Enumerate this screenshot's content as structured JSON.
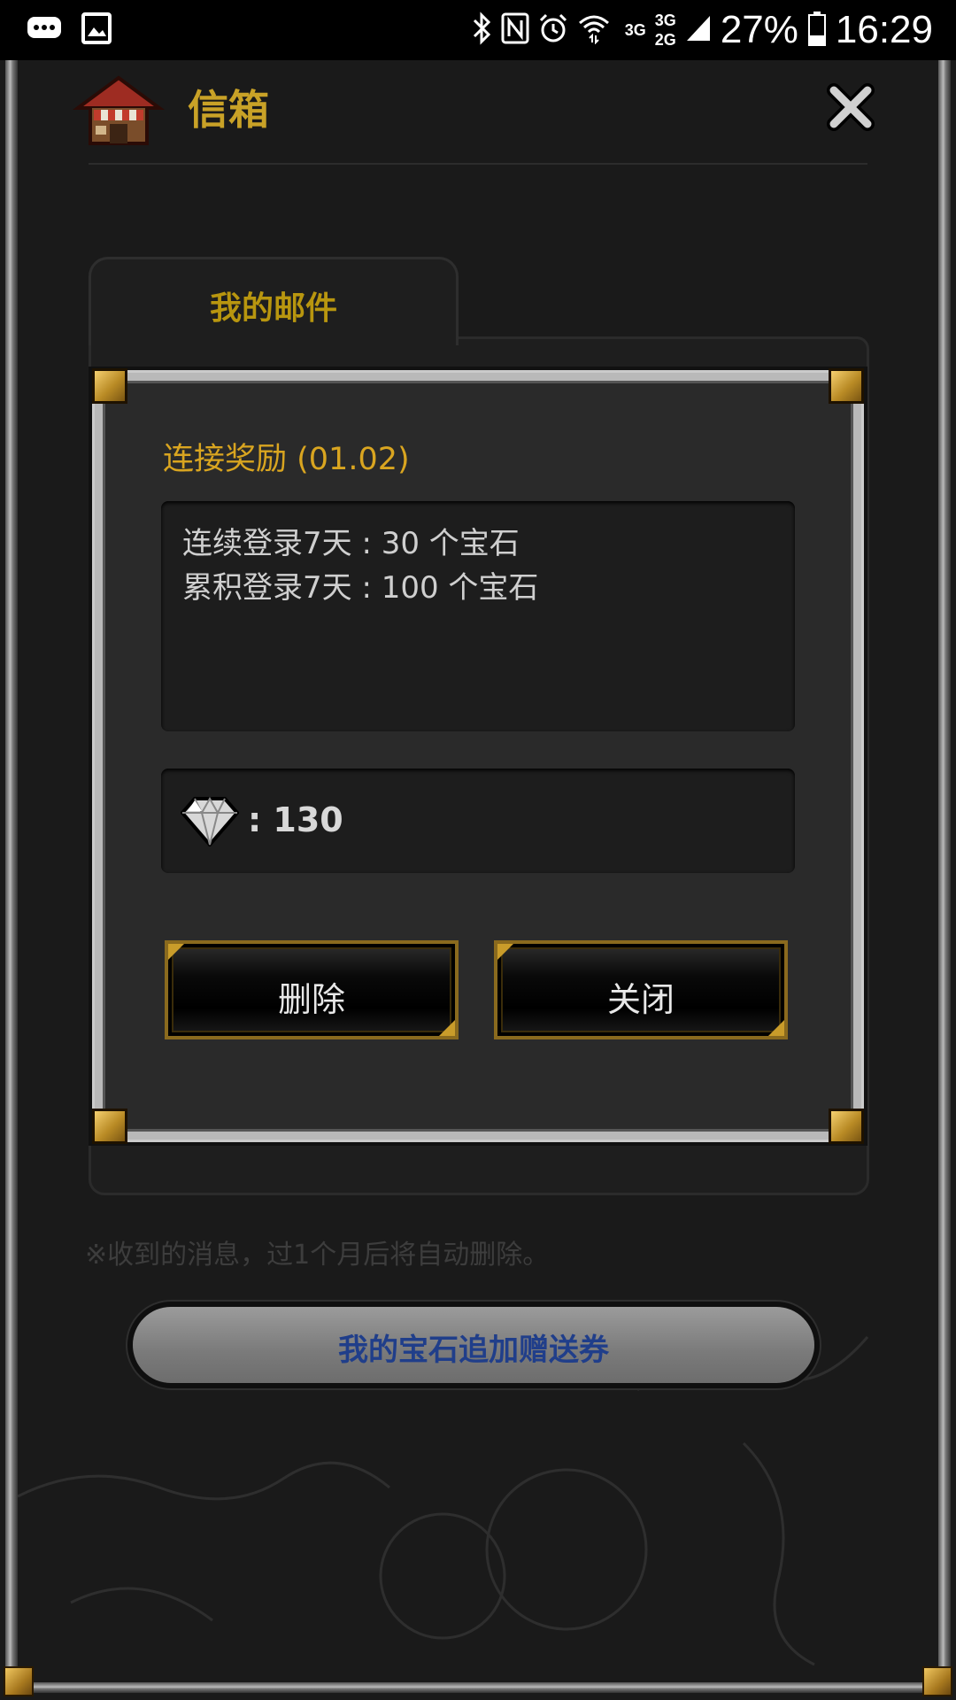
{
  "status_bar": {
    "network_3g_top": "3G",
    "network_3g_2g_top": "3G",
    "network_2g_bottom": "2G",
    "battery": "27%",
    "time": "16:29"
  },
  "header": {
    "title": "信箱"
  },
  "tabs": [
    {
      "label": "我的邮件"
    }
  ],
  "message": {
    "title": "连接奖励 (01.02)",
    "body_lines": [
      "连续登录7天 : 30 个宝石",
      "累积登录7天 : 100 个宝石"
    ],
    "reward_text": ": 130"
  },
  "buttons": {
    "delete": "删除",
    "close": "关闭"
  },
  "notice": "※收到的消息，过1个月后将自动删除。",
  "coupon_button": "我的宝石追加赠送券",
  "colors": {
    "accent_gold": "#c9a227",
    "coupon_text": "#203e8a",
    "frame_silver": "#b9b9b9"
  }
}
